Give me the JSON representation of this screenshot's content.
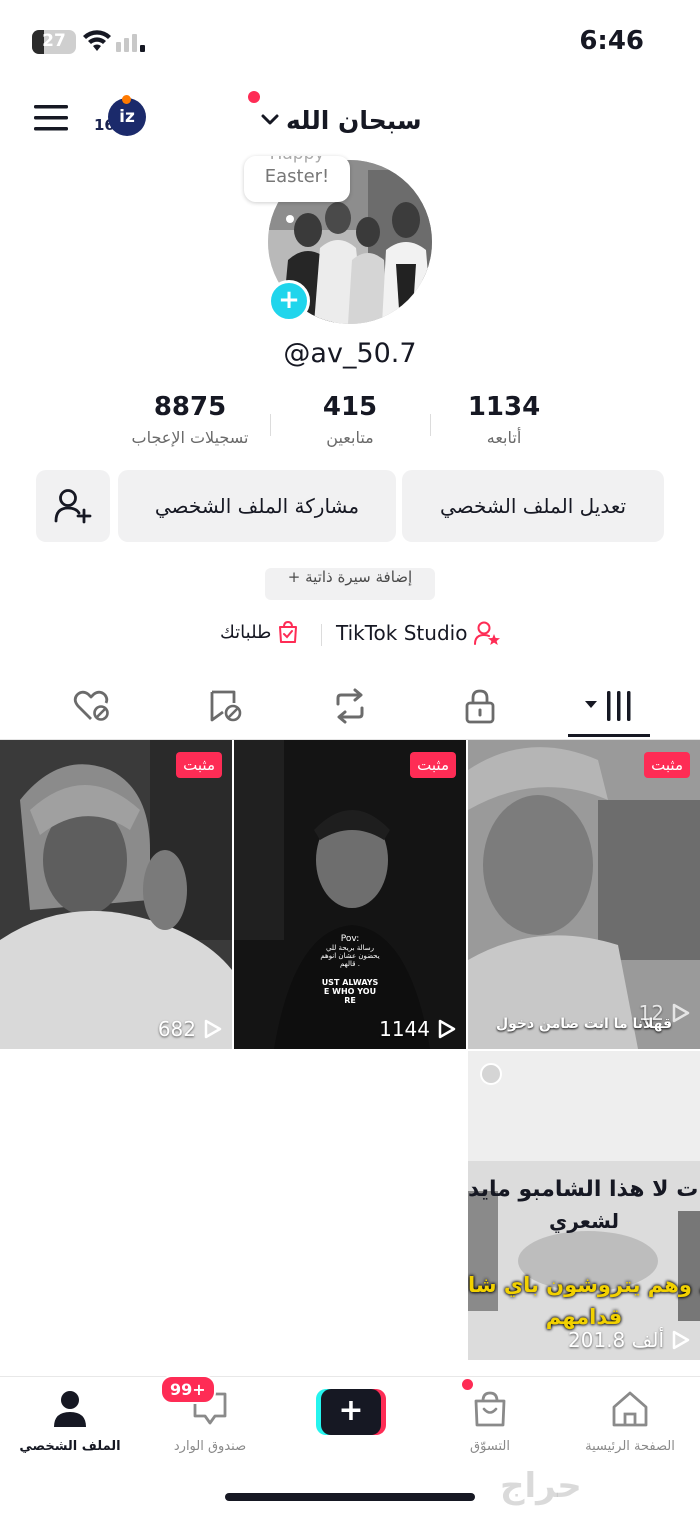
{
  "status_bar": {
    "battery_level": "27",
    "battery_fraction": 0.27,
    "time": "6:46"
  },
  "header": {
    "menu_icon": "hamburger-menu-icon",
    "badge_number": "16",
    "badge_text": "iz",
    "username": "سبحان الله"
  },
  "avatar": {
    "story_line1": "Happy",
    "story_line2": "Easter!",
    "add_label": "+"
  },
  "profile": {
    "handle": "@av_50.7",
    "stats": [
      {
        "value": "8875",
        "label": "تسجيلات الإعجاب"
      },
      {
        "value": "415",
        "label": "متابعين"
      },
      {
        "value": "1134",
        "label": "أتابعه"
      }
    ],
    "add_friend_icon": "add-user-icon",
    "share_profile_label": "مشاركة الملف الشخصي",
    "edit_profile_label": "تعديل الملف الشخصي",
    "add_bio_label": "+ إضافة سيرة ذاتية",
    "orders_label": "طلباتك",
    "studio_label": "TikTok Studio"
  },
  "tabs": [
    {
      "icon": "liked-hidden-icon"
    },
    {
      "icon": "favorites-hidden-icon"
    },
    {
      "icon": "repost-icon"
    },
    {
      "icon": "lock-icon"
    },
    {
      "icon": "videos-grid-icon",
      "active": true
    }
  ],
  "videos": [
    {
      "pinned_label": "مثبت",
      "views": "682"
    },
    {
      "pinned_label": "مثبت",
      "views": "1144",
      "caption_lines": [
        "Pov:",
        "رسالة بريحة للي",
        "يحضون عشان انوهم",
        "قالهم .",
        "UST ALWAYS",
        "E WHO YOU",
        "RE"
      ]
    },
    {
      "pinned_label": "مثبت",
      "views": "12",
      "caption": "قهلانا ما انت ضامن دخول"
    },
    {
      "views": "201.8 ألف",
      "caption_lines": [
        "ات لا هذا الشامبو مايد",
        "لشعري",
        "يال وهم يتروشون باي شا",
        "قدامهم"
      ]
    }
  ],
  "bottom_nav": {
    "items": [
      {
        "label": "الملف الشخصي",
        "icon": "profile-icon",
        "active": true
      },
      {
        "label": "صندوق الوارد",
        "icon": "inbox-icon",
        "badge": "99+"
      },
      {
        "label": "",
        "icon": "plus-icon"
      },
      {
        "label": "التسوّق",
        "icon": "shop-bag-icon"
      },
      {
        "label": "الصفحة الرئيسية",
        "icon": "home-icon"
      }
    ]
  },
  "watermark": "حراج"
}
